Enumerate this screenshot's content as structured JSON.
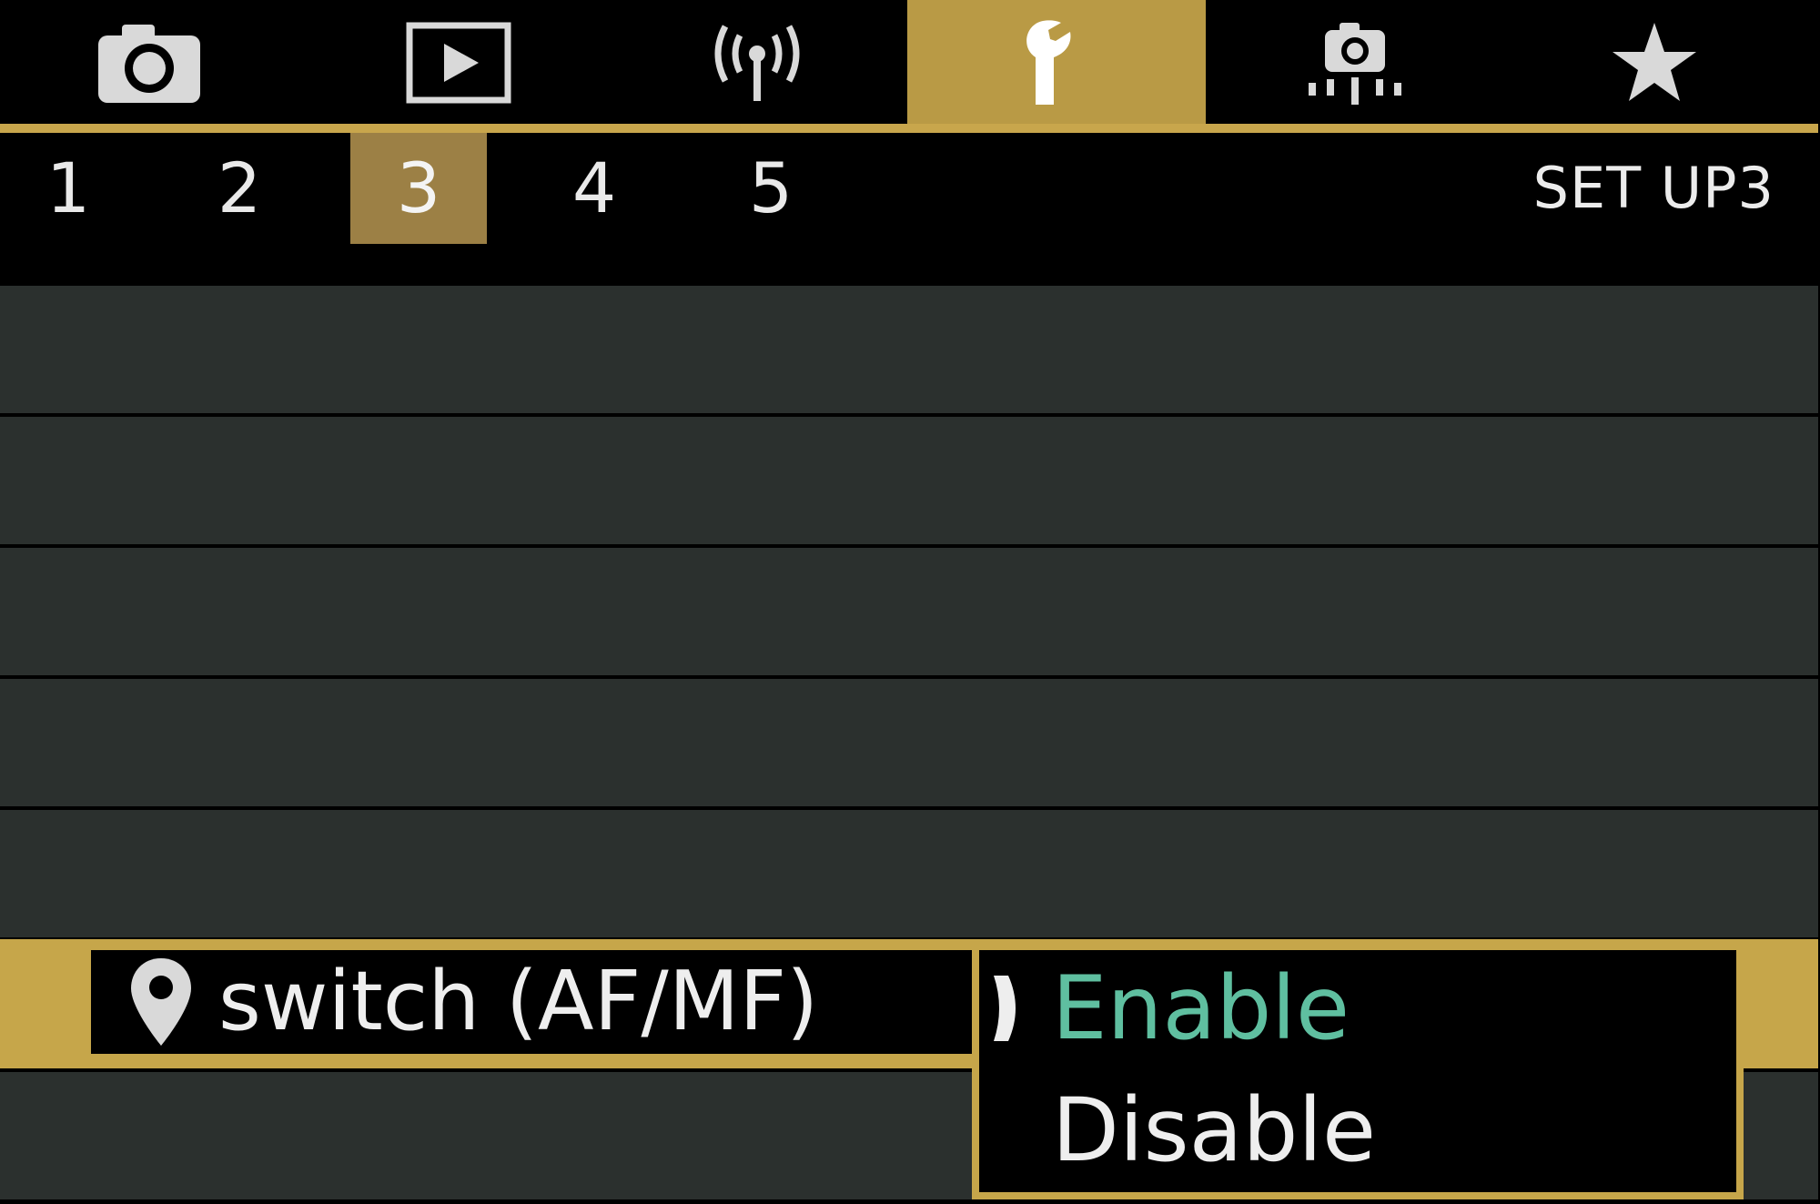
{
  "tabs": [
    {
      "icon": "camera-icon",
      "active": false
    },
    {
      "icon": "playback-icon",
      "active": false
    },
    {
      "icon": "wireless-icon",
      "active": false
    },
    {
      "icon": "wrench-icon",
      "active": true
    },
    {
      "icon": "custom-function-icon",
      "active": false
    },
    {
      "icon": "star-icon",
      "active": false
    }
  ],
  "subtabs": [
    "1",
    "2",
    "3",
    "4",
    "5"
  ],
  "active_subtab": "3",
  "page_label": "SET UP3",
  "selected_item": {
    "icon": "location-pin-icon",
    "label": "switch (AF/MF)"
  },
  "options": [
    {
      "label": "Enable",
      "selected": true
    },
    {
      "label": "Disable",
      "selected": false
    }
  ],
  "colors": {
    "accent": "#c6a64a",
    "active_subtab_bg": "#9c8045",
    "row_bg": "#2b302e",
    "selected_option_text": "#5fbfa0",
    "text": "#eeeeee"
  }
}
